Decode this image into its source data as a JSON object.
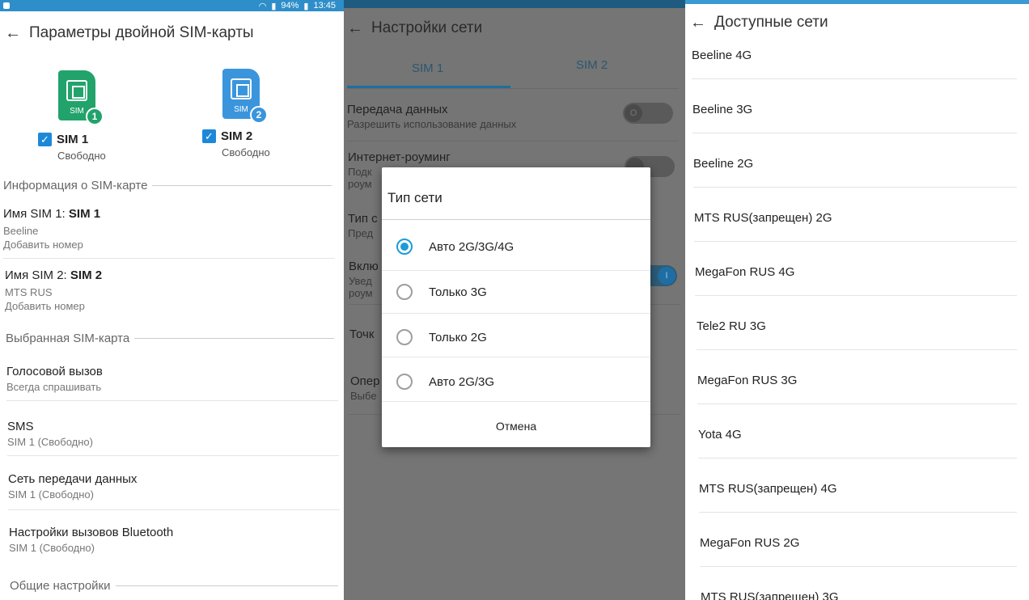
{
  "panel1": {
    "status_bar": {
      "battery": "94%",
      "time": "13:45"
    },
    "title": "Параметры двойной SIM-карты",
    "sims": [
      {
        "name": "SIM 1",
        "status": "Свободно",
        "number": "1",
        "card_label": "SIM",
        "color": "#21a36b"
      },
      {
        "name": "SIM 2",
        "status": "Свободно",
        "number": "2",
        "card_label": "SIM",
        "color": "#3a95dd"
      }
    ],
    "sim_info_header": "Информация о SIM-карте",
    "sim1_info": {
      "label": "Имя SIM 1: ",
      "name": "SIM 1",
      "operator": "Beeline",
      "action": "Добавить номер"
    },
    "sim2_info": {
      "label": "Имя SIM 2: ",
      "name": "SIM 2",
      "operator": "MTS RUS",
      "action": "Добавить номер"
    },
    "selected_sim_header": "Выбранная SIM-карта",
    "items": [
      {
        "title": "Голосовой вызов",
        "subtitle": "Всегда спрашивать"
      },
      {
        "title": "SMS",
        "subtitle": "SIM 1 (Свободно)"
      },
      {
        "title": "Сеть передачи данных",
        "subtitle": "SIM 1 (Свободно)"
      },
      {
        "title": "Настройки вызовов Bluetooth",
        "subtitle": "SIM 1 (Свободно)"
      }
    ],
    "general_header": "Общие настройки"
  },
  "panel2": {
    "title": "Настройки сети",
    "tabs": [
      "SIM 1",
      "SIM 2"
    ],
    "settings": [
      {
        "title": "Передача данных",
        "subtitle": "Разрешить использование данных"
      },
      {
        "title": "Интернет-роуминг",
        "subtitle": "Подк"
      },
      {
        "title": "Тип с",
        "subtitle": "Пред"
      },
      {
        "title": "Вклю",
        "subtitle": "Увед"
      },
      {
        "title": "Точк",
        "subtitle": ""
      },
      {
        "title": "Опер",
        "subtitle": "Выбе"
      }
    ],
    "settings_extra": {
      "roaming_sub2": "роум",
      "notify_sub2": "роум"
    },
    "toggles": {
      "data_off_label": "O",
      "notify_on_label": "I"
    },
    "dialog": {
      "title": "Тип сети",
      "options": [
        "Авто 2G/3G/4G",
        "Только 3G",
        "Только 2G",
        "Авто 2G/3G"
      ],
      "selected_index": 0,
      "cancel": "Отмена"
    }
  },
  "panel3": {
    "title": "Доступные сети",
    "networks": [
      "Beeline 4G",
      "Beeline 3G",
      "Beeline 2G",
      "MTS RUS(запрещен) 2G",
      "MegaFon RUS 4G",
      "Tele2 RU 3G",
      "MegaFon RUS 3G",
      "Yota 4G",
      "MTS RUS(запрещен) 4G",
      "MegaFon RUS 2G",
      "MTS RUS(запрещен) 3G"
    ]
  }
}
